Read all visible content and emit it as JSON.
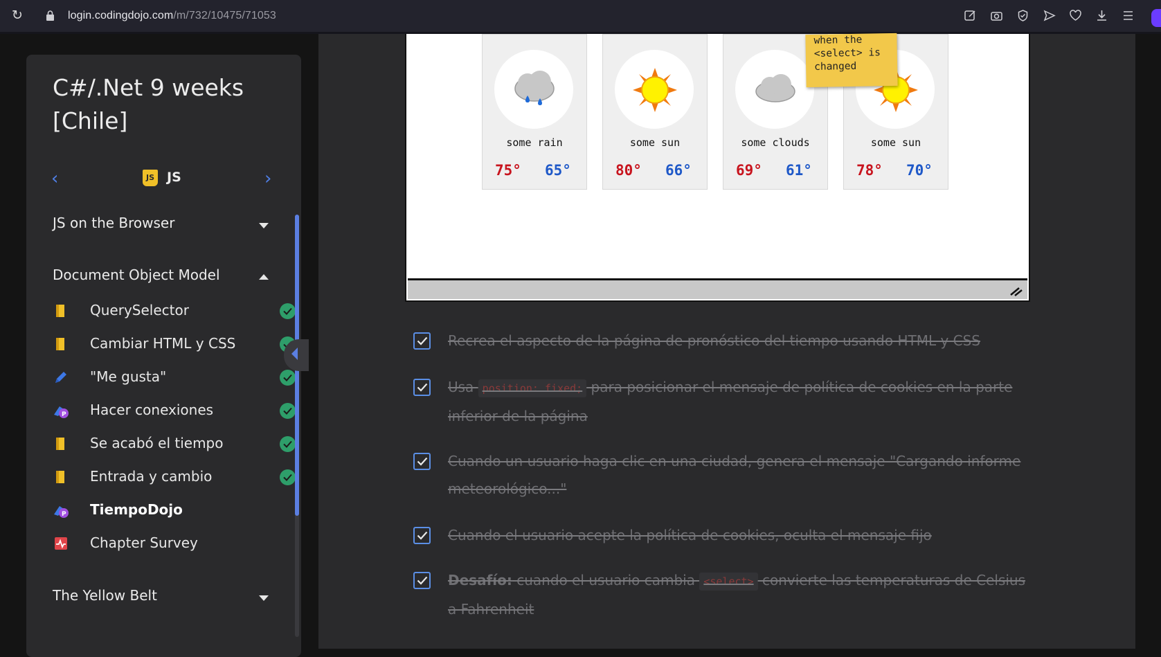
{
  "browser": {
    "url_domain": "login.codingdojo.com",
    "url_path": "/m/732/10475/71053"
  },
  "sidebar": {
    "course_title": "C#/.Net 9 weeks [Chile]",
    "track_label": "JS",
    "track_badge": "JS",
    "sections": [
      {
        "label": "JS on the Browser",
        "expanded": false
      },
      {
        "label": "Document Object Model",
        "expanded": true
      },
      {
        "label": "The Yellow Belt",
        "expanded": false
      }
    ],
    "lessons": [
      {
        "label": "QuerySelector",
        "icon": "book-icon",
        "done": true,
        "current": false
      },
      {
        "label": "Cambiar HTML y CSS",
        "icon": "book-icon",
        "done": true,
        "current": false
      },
      {
        "label": "\"Me gusta\"",
        "icon": "pencil-icon",
        "done": true,
        "current": false
      },
      {
        "label": "Hacer conexiones",
        "icon": "practice-icon",
        "done": true,
        "current": false
      },
      {
        "label": "Se acabó el tiempo",
        "icon": "book-icon",
        "done": true,
        "current": false
      },
      {
        "label": "Entrada y cambio",
        "icon": "book-icon",
        "done": true,
        "current": false
      },
      {
        "label": "TiempoDojo",
        "icon": "practice-icon",
        "done": false,
        "current": true
      },
      {
        "label": "Chapter Survey",
        "icon": "survey-icon",
        "done": false,
        "current": false
      }
    ]
  },
  "weather": {
    "cards": [
      {
        "condition": "some rain",
        "high": "75°",
        "low": "65°",
        "icon": "rain-cloud-icon"
      },
      {
        "condition": "some sun",
        "high": "80°",
        "low": "66°",
        "icon": "sun-icon"
      },
      {
        "condition": "some clouds",
        "high": "69°",
        "low": "61°",
        "icon": "cloud-icon"
      },
      {
        "condition": "some sun",
        "high": "78°",
        "low": "70°",
        "icon": "sun-icon"
      }
    ],
    "sticky_note": "when the\n<select> is\nchanged"
  },
  "tasks": {
    "t1": "Recrea el aspecto de la página de pronóstico del tiempo usando HTML y CSS",
    "t2_before": "Usa ",
    "t2_code": "position: fixed;",
    "t2_after": " para posicionar el mensaje de política de cookies en la parte inferior de la página",
    "t3": "Cuando un usuario haga clic en una ciudad, genera el mensaje \"Cargando informe meteorológico...\"",
    "t4": "Cuando el usuario acepte la política de cookies, oculta el mensaje fijo",
    "t5_bold": "Desafío:",
    "t5_before": " cuando el usuario cambia ",
    "t5_code": "<select>",
    "t5_after": " convierte las temperaturas de Celsius a Fahrenheit"
  },
  "colors": {
    "accent": "#5b8fe6",
    "check_green": "#2e9e6a",
    "temp_high": "#c8141e",
    "temp_low": "#1e58c8",
    "sticky": "#f2c84a"
  }
}
